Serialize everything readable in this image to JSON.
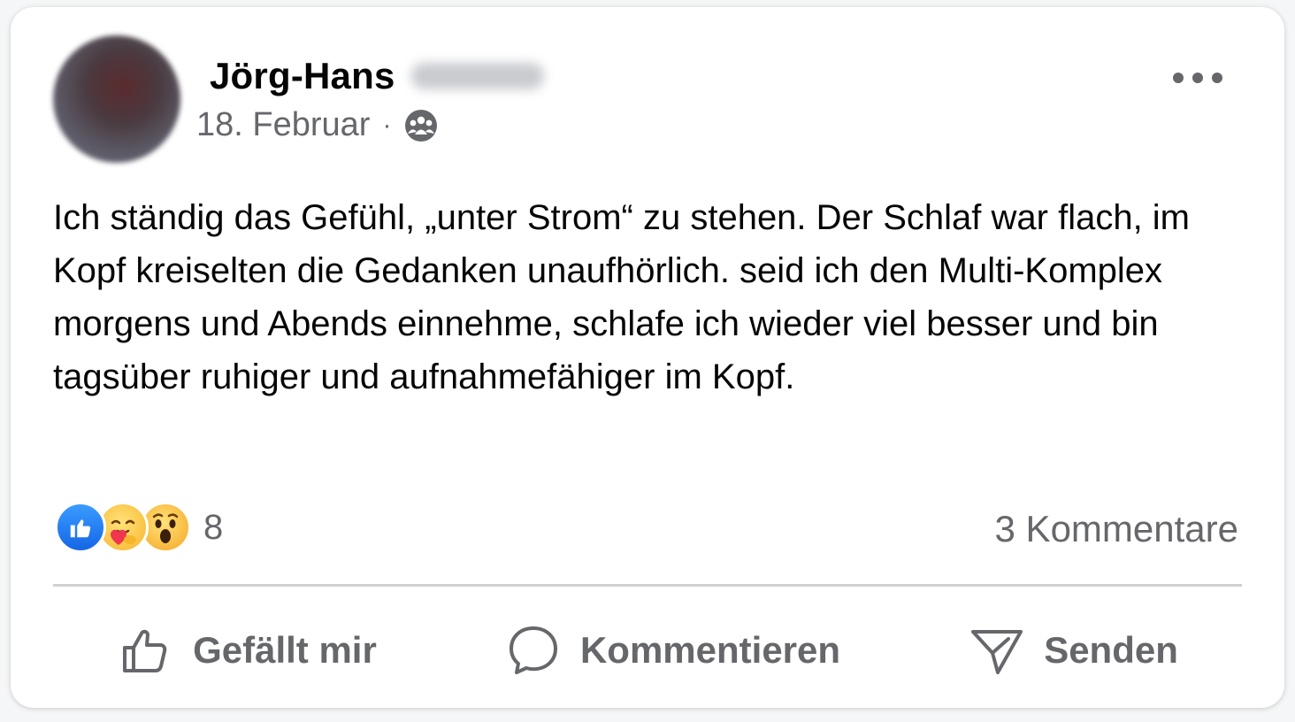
{
  "post": {
    "author_first": "Jörg-Hans",
    "date": "18. Februar",
    "separator": "·",
    "audience_icon": "group-icon",
    "text": "Ich ständig das Gefühl, „unter Strom“ zu stehen. Der Schlaf war flach, im Kopf kreiselten die Gedanken unaufhörlich. seid ich den Multi-Komplex morgens und Abends einnehme, schlafe ich wieder viel besser und bin tagsüber ruhiger und aufnahmefähiger im Kopf."
  },
  "reactions": {
    "icons": [
      "like-reaction-icon",
      "care-reaction-icon",
      "wow-reaction-icon"
    ],
    "count": "8"
  },
  "comments": {
    "label": "3 Kommentare"
  },
  "actions": {
    "like_label": "Gefällt mir",
    "comment_label": "Kommentieren",
    "share_label": "Senden"
  },
  "colors": {
    "secondary_text": "#65676b",
    "like_blue": "#1877f2",
    "divider": "#ced0d4"
  }
}
